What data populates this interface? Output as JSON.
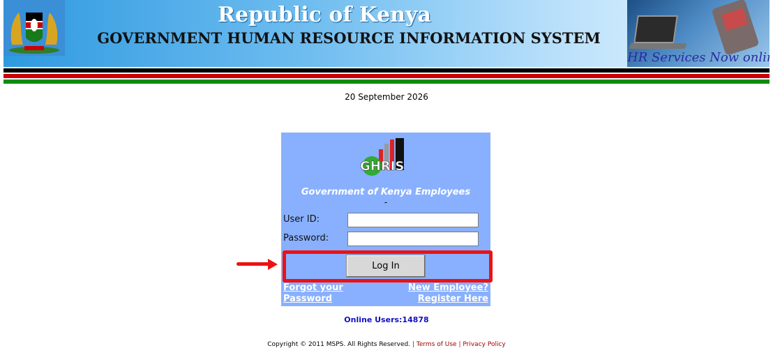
{
  "header": {
    "title": "Republic of Kenya",
    "subtitle": "GOVERNMENT HUMAN RESOURCE INFORMATION SYSTEM",
    "tagline": "HR Services Now online"
  },
  "date": "20 September 2026",
  "login": {
    "logo_text": "GHRIS",
    "heading": "Government of Kenya Employees",
    "dash": "-",
    "user_label": "User ID:",
    "user_value": "",
    "password_label": "Password:",
    "password_value": "",
    "login_button": "Log In",
    "forgot_line1": "Forgot your",
    "forgot_line2": "Password",
    "new_line1": "New Employee?",
    "new_line2": "Register Here"
  },
  "online_users": "Online Users:14878",
  "footer": {
    "copyright": "Copyright © 2011 MSPS. All Rights Reserved.",
    "separator": "|",
    "terms": "Terms of Use",
    "privacy": "Privacy Policy"
  },
  "colors": {
    "login_panel": "#88b0ff",
    "highlight": "#ee1111",
    "flag_black": "#000000",
    "flag_red": "#cc0000",
    "flag_green": "#108a10"
  },
  "icons": [
    "coat-of-arms-icon",
    "ghris-logo-icon",
    "arrow-right-icon"
  ]
}
